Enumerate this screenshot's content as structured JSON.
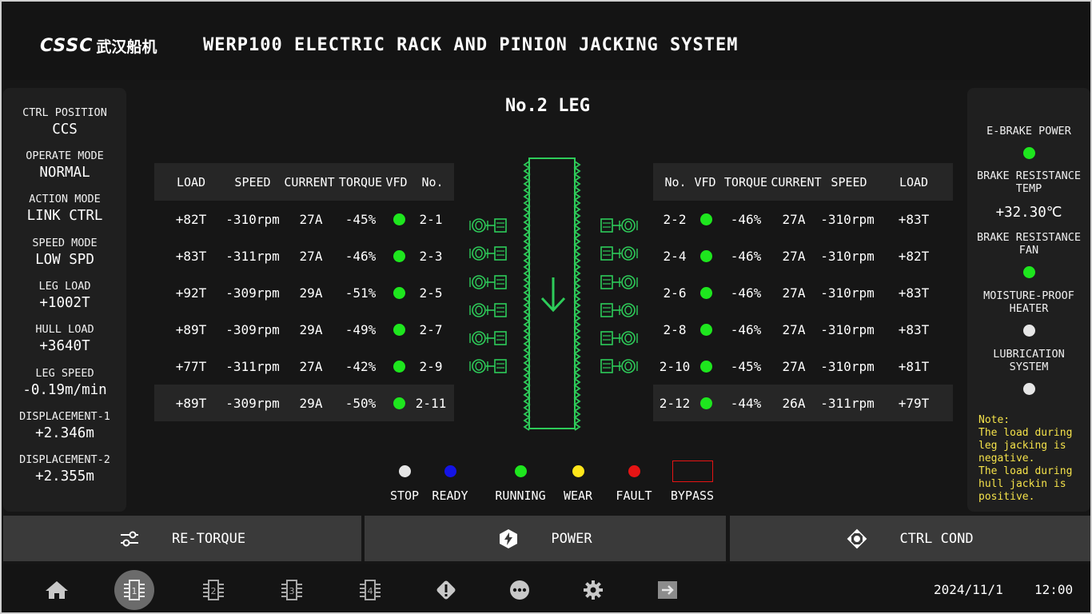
{
  "header": {
    "logo_mark": "CSSC",
    "logo_cn": "武汉船机",
    "title": "WERP100 ELECTRIC RACK AND PINION JACKING SYSTEM"
  },
  "left_panel": {
    "items": [
      {
        "label": "CTRL POSITION",
        "value": "CCS"
      },
      {
        "label": "OPERATE MODE",
        "value": "NORMAL"
      },
      {
        "label": "ACTION MODE",
        "value": "LINK CTRL"
      },
      {
        "label": "SPEED MODE",
        "value": "LOW SPD"
      },
      {
        "label": "LEG LOAD",
        "value": "+1002T"
      },
      {
        "label": "HULL LOAD",
        "value": "+3640T"
      },
      {
        "label": "LEG SPEED",
        "value": "-0.19m/min"
      },
      {
        "label": "DISPLACEMENT-1",
        "value": "+2.346m"
      },
      {
        "label": "DISPLACEMENT-2",
        "value": "+2.355m"
      }
    ]
  },
  "main": {
    "leg_title": "No.2 LEG",
    "left_table": {
      "headers": [
        "LOAD",
        "SPEED",
        "CURRENT",
        "TORQUE",
        "VFD",
        "No."
      ],
      "rows": [
        {
          "load": "+82T",
          "speed": "-310rpm",
          "current": "27A",
          "torque": "-45%",
          "no": "2-1"
        },
        {
          "load": "+83T",
          "speed": "-311rpm",
          "current": "27A",
          "torque": "-46%",
          "no": "2-3"
        },
        {
          "load": "+92T",
          "speed": "-309rpm",
          "current": "29A",
          "torque": "-51%",
          "no": "2-5"
        },
        {
          "load": "+89T",
          "speed": "-309rpm",
          "current": "29A",
          "torque": "-49%",
          "no": "2-7"
        },
        {
          "load": "+77T",
          "speed": "-311rpm",
          "current": "27A",
          "torque": "-42%",
          "no": "2-9"
        },
        {
          "load": "+89T",
          "speed": "-309rpm",
          "current": "29A",
          "torque": "-50%",
          "no": "2-11"
        }
      ]
    },
    "right_table": {
      "headers": [
        "No.",
        "VFD",
        "TORQUE",
        "CURRENT",
        "SPEED",
        "LOAD"
      ],
      "rows": [
        {
          "no": "2-2",
          "torque": "-46%",
          "current": "27A",
          "speed": "-310rpm",
          "load": "+83T"
        },
        {
          "no": "2-4",
          "torque": "-46%",
          "current": "27A",
          "speed": "-310rpm",
          "load": "+82T"
        },
        {
          "no": "2-6",
          "torque": "-46%",
          "current": "27A",
          "speed": "-310rpm",
          "load": "+83T"
        },
        {
          "no": "2-8",
          "torque": "-46%",
          "current": "27A",
          "speed": "-310rpm",
          "load": "+83T"
        },
        {
          "no": "2-10",
          "torque": "-45%",
          "current": "27A",
          "speed": "-310rpm",
          "load": "+81T"
        },
        {
          "no": "2-12",
          "torque": "-44%",
          "current": "26A",
          "speed": "-311rpm",
          "load": "+79T"
        }
      ]
    },
    "legend": [
      {
        "label": "STOP",
        "color": "#e6e6e6"
      },
      {
        "label": "READY",
        "color": "#1414e6"
      },
      {
        "label": "RUNNING",
        "color": "#1ee61e"
      },
      {
        "label": "WEAR",
        "color": "#ffe61a"
      },
      {
        "label": "FAULT",
        "color": "#e61414"
      },
      {
        "label": "BYPASS",
        "color": "#e61414"
      }
    ],
    "vfd_color": "#1ee61e",
    "leg_color": "#2ecc5a"
  },
  "right_panel": {
    "ebrake_label": "E-BRAKE POWER",
    "brake_temp_label_1": "BRAKE RESISTANCE",
    "brake_temp_label_2": "TEMP",
    "brake_temp_value": "+32.30℃",
    "brake_fan_label_1": "BRAKE RESISTANCE",
    "brake_fan_label_2": "FAN",
    "heater_label_1": "MOISTURE-PROOF",
    "heater_label_2": "HEATER",
    "lube_label_1": "LUBRICATION",
    "lube_label_2": "SYSTEM",
    "note_title": "Note:",
    "note_1": "The load during leg jacking is negative.",
    "note_2": "The load during hull jackin is positive.",
    "status_colors": {
      "ebrake": "#1ee61e",
      "fan": "#1ee61e",
      "heater": "#e6e6e6",
      "lube": "#e6e6e6"
    }
  },
  "actions": {
    "retorque": "RE-TORQUE",
    "power": "POWER",
    "ctrl_cond": "CTRL COND"
  },
  "navbar": {
    "items": [
      "home-icon",
      "leg-1-icon",
      "leg-2-icon",
      "leg-3-icon",
      "leg-4-icon",
      "alarm-icon",
      "more-icon",
      "settings-icon",
      "exit-icon"
    ],
    "leg_numbers": [
      "1",
      "2",
      "3",
      "4"
    ],
    "date": "2024/11/1",
    "time": "12:00"
  }
}
